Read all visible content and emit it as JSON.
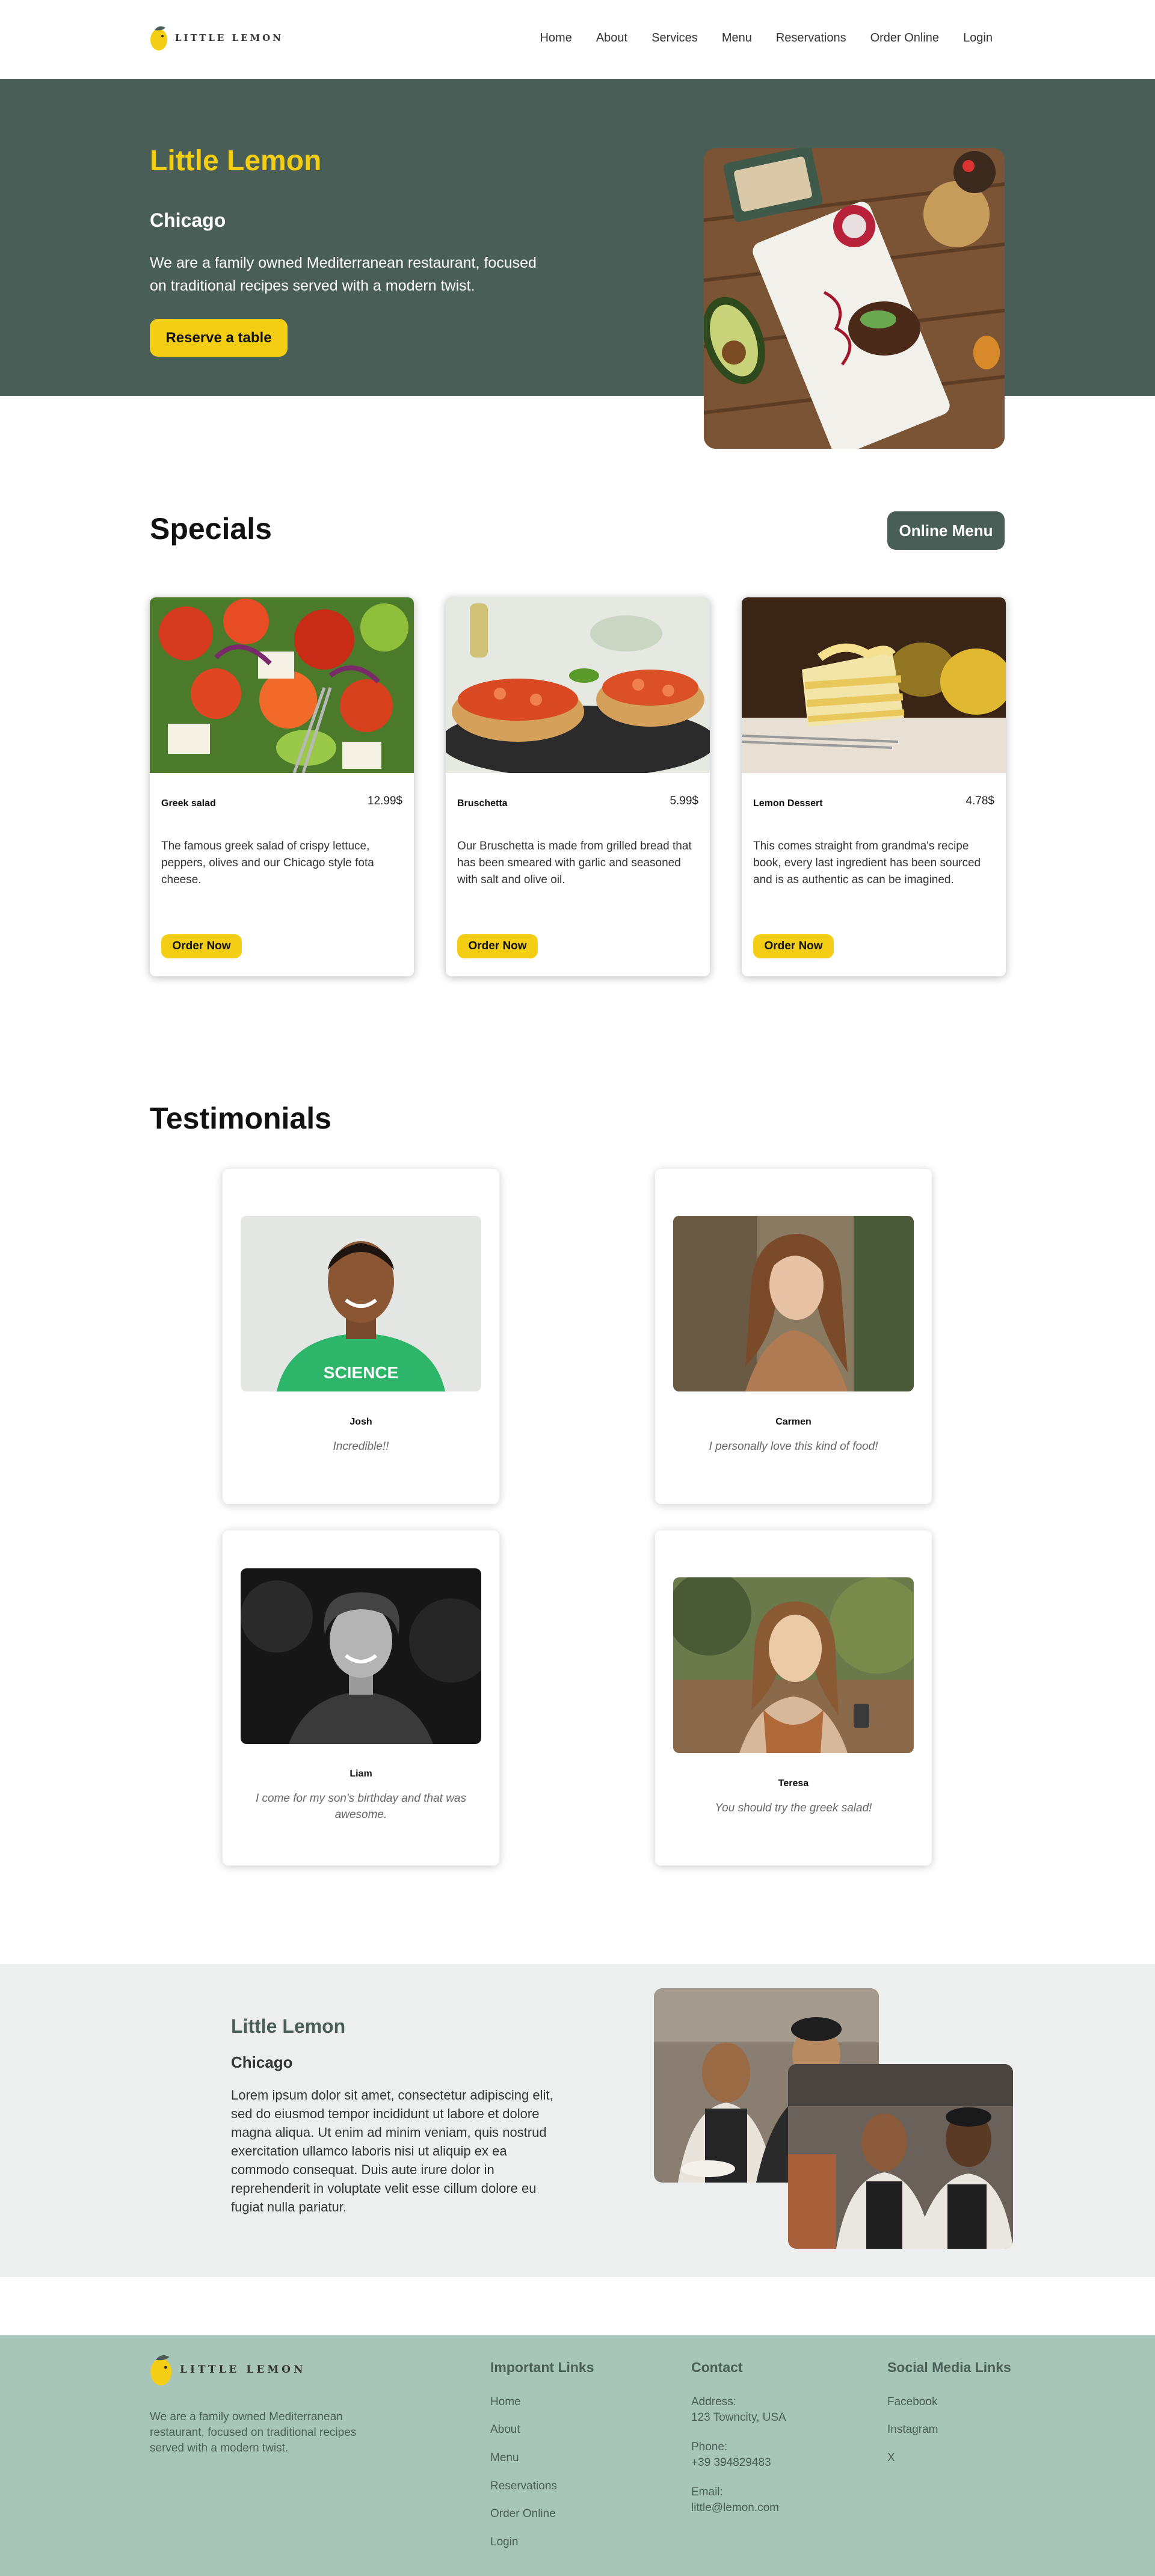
{
  "header": {
    "logo_text": "LITTLE LEMON",
    "nav": [
      "Home",
      "About",
      "Services",
      "Menu",
      "Reservations",
      "Order Online",
      "Login"
    ]
  },
  "hero": {
    "title": "Little Lemon",
    "subtitle": "Chicago",
    "description": "We are a family owned Mediterranean restaurant, focused on traditional recipes served with a modern twist.",
    "button": "Reserve a table"
  },
  "specials": {
    "title": "Specials",
    "menu_button": "Online Menu",
    "items": [
      {
        "name": "Greek salad",
        "price": "12.99$",
        "description": "The famous greek salad of crispy lettuce, peppers, olives and our Chicago style fota cheese.",
        "button": "Order Now"
      },
      {
        "name": "Bruschetta",
        "price": "5.99$",
        "description": "Our Bruschetta is made from grilled bread that has been smeared with garlic and seasoned with salt and olive oil.",
        "button": "Order Now"
      },
      {
        "name": "Lemon Dessert",
        "price": "4.78$",
        "description": "This comes straight from grandma's recipe book, every last ingredient has been sourced and is as authentic as can be imagined.",
        "button": "Order Now"
      }
    ]
  },
  "testimonials": {
    "title": "Testimonials",
    "items": [
      {
        "name": "Josh",
        "quote": "Incredible!!"
      },
      {
        "name": "Carmen",
        "quote": "I personally love this kind of food!"
      },
      {
        "name": "Liam",
        "quote": "I come for my son's birthday and that was awesome."
      },
      {
        "name": "Teresa",
        "quote": "You should try the greek salad!"
      }
    ]
  },
  "about": {
    "title": "Little Lemon",
    "subtitle": "Chicago",
    "description": "Lorem ipsum dolor sit amet, consectetur adipiscing elit, sed do eiusmod tempor incididunt ut labore et dolore magna aliqua. Ut enim ad minim veniam, quis nostrud exercitation ullamco laboris nisi ut aliquip ex ea commodo consequat. Duis aute irure dolor in reprehenderit in voluptate velit esse cillum dolore eu fugiat nulla pariatur."
  },
  "footer": {
    "logo_text": "LITTLE LEMON",
    "description": "We are a family owned Mediterranean restaurant, focused on traditional recipes served with a modern twist.",
    "important_links": {
      "title": "Important Links",
      "links": [
        "Home",
        "About",
        "Menu",
        "Reservations",
        "Order Online",
        "Login"
      ]
    },
    "contact": {
      "title": "Contact",
      "address_label": "Address:",
      "address": "123 Towncity, USA",
      "phone_label": "Phone:",
      "phone": "+39 394829483",
      "email_label": "Email:",
      "email": "little@lemon.com"
    },
    "social": {
      "title": "Social Media Links",
      "links": [
        "Facebook",
        "Instagram",
        "X"
      ]
    }
  },
  "colors": {
    "primary_green": "#495e57",
    "primary_yellow": "#f4ce14",
    "light_gray": "#edefee",
    "footer_green": "#a8c5b9"
  }
}
